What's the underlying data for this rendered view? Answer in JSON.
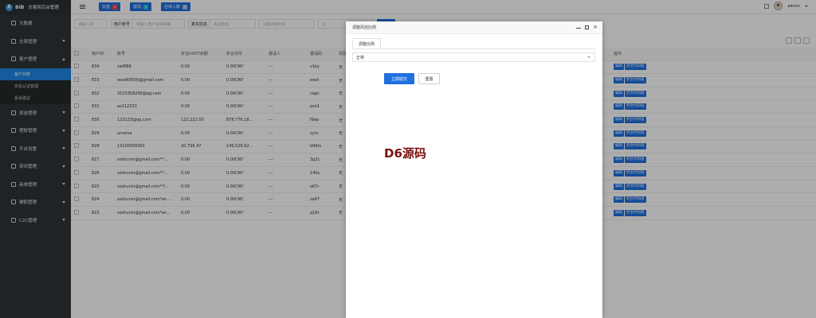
{
  "app": {
    "logo_mark": "B",
    "brand": "BiB",
    "title": "交易所后台管理"
  },
  "sidebar": {
    "items": [
      {
        "label": "大数据",
        "icon": "dashboard-icon",
        "has_caret": false
      },
      {
        "label": "交易管理",
        "icon": "exchange-icon",
        "has_caret": true
      },
      {
        "label": "客户管理",
        "icon": "user-icon",
        "has_caret": true,
        "open": true,
        "children": [
          {
            "label": "客户列表",
            "active": true
          },
          {
            "label": "实名认证管理",
            "active": false
          },
          {
            "label": "投诉建议",
            "active": false
          }
        ]
      },
      {
        "label": "资金管理",
        "icon": "money-icon",
        "has_caret": true
      },
      {
        "label": "理财管理",
        "icon": "finance-icon",
        "has_caret": true
      },
      {
        "label": "平台设置",
        "icon": "settings-icon",
        "has_caret": true
      },
      {
        "label": "资讯管理",
        "icon": "news-icon",
        "has_caret": true
      },
      {
        "label": "商单管理",
        "icon": "order-icon",
        "has_caret": true
      },
      {
        "label": "辅助管理",
        "icon": "tool-icon",
        "has_caret": true
      },
      {
        "label": "C2C管理",
        "icon": "c2c-icon",
        "has_caret": true
      }
    ]
  },
  "topbar": {
    "buttons": [
      {
        "label": "充值",
        "count": "3",
        "count_color": "red"
      },
      {
        "label": "提现",
        "count": "1",
        "count_color": "cyan"
      },
      {
        "label": "在线人数",
        "count": "0",
        "count_color": "gray"
      }
    ],
    "user": "admin"
  },
  "filters": {
    "uid_placeholder": "请输入ID",
    "account_label": "用户账号",
    "account_placeholder": "请输入用户名或邮箱",
    "realname_label": "真实姓名",
    "realname_placeholder": "真实姓名",
    "date_placeholder": "注册开始时间",
    "date2_placeholder": "注"
  },
  "table": {
    "headers": [
      "用户ID",
      "账号",
      "折合USDT余额",
      "折合法币",
      "邀请人",
      "邀请码",
      "风控"
    ],
    "op_header": "操作",
    "op_edit": "编辑",
    "op_ratio": "折合代码值",
    "rows": [
      [
        "834",
        "zwl888",
        "0.00",
        "0.00CNY",
        "---",
        "v1ky",
        "无"
      ],
      [
        "833",
        "wow69500@gmail.com",
        "0.00",
        "0.00CNY",
        "---",
        "ewzi",
        "无"
      ],
      [
        "832",
        "2523358290@qq.com",
        "0.00",
        "0.00CNY",
        "---",
        "capc",
        "无"
      ],
      [
        "831",
        "as112233",
        "0.00",
        "0.00CNY",
        "---",
        "pso1",
        "无"
      ],
      [
        "830",
        "123123@qq.com",
        "122,222.00",
        "878,776.18...",
        "---",
        "f9aa",
        "无"
      ],
      [
        "829",
        "umaiva",
        "0.00",
        "0.00CNY",
        "---",
        "sym",
        "无"
      ],
      [
        "828",
        "13100000001",
        "20,796.47",
        "149,526.62...",
        "---",
        "b96m",
        "无"
      ],
      [
        "827",
        "soshunin@gmail.com**...",
        "0.00",
        "0.00CNY",
        "---",
        "3g2c",
        "无"
      ],
      [
        "826",
        "soshunin@gmail.com**...",
        "0.00",
        "0.00CNY",
        "---",
        "140s",
        "无"
      ],
      [
        "825",
        "soshunin@gmail.com**/...",
        "0.00",
        "0.00CNY",
        "---",
        "o67r",
        "无"
      ],
      [
        "824",
        "soshunin@gmail.com*an...",
        "0.00",
        "0.00CNY",
        "---",
        "sa67",
        "无"
      ],
      [
        "823",
        "soshunin@gmail.com*an...",
        "0.00",
        "0.00CNY",
        "---",
        "q16r",
        "无"
      ]
    ]
  },
  "modal": {
    "title": "调整风控比例",
    "tab": "调整比例",
    "select_value": "正常",
    "submit_label": "立即提交",
    "reset_label": "重置",
    "watermark": "D6源码"
  },
  "colors": {
    "primary": "#1e6fe0",
    "sidebar": "#2f3437",
    "watermark": "#7a1010"
  }
}
